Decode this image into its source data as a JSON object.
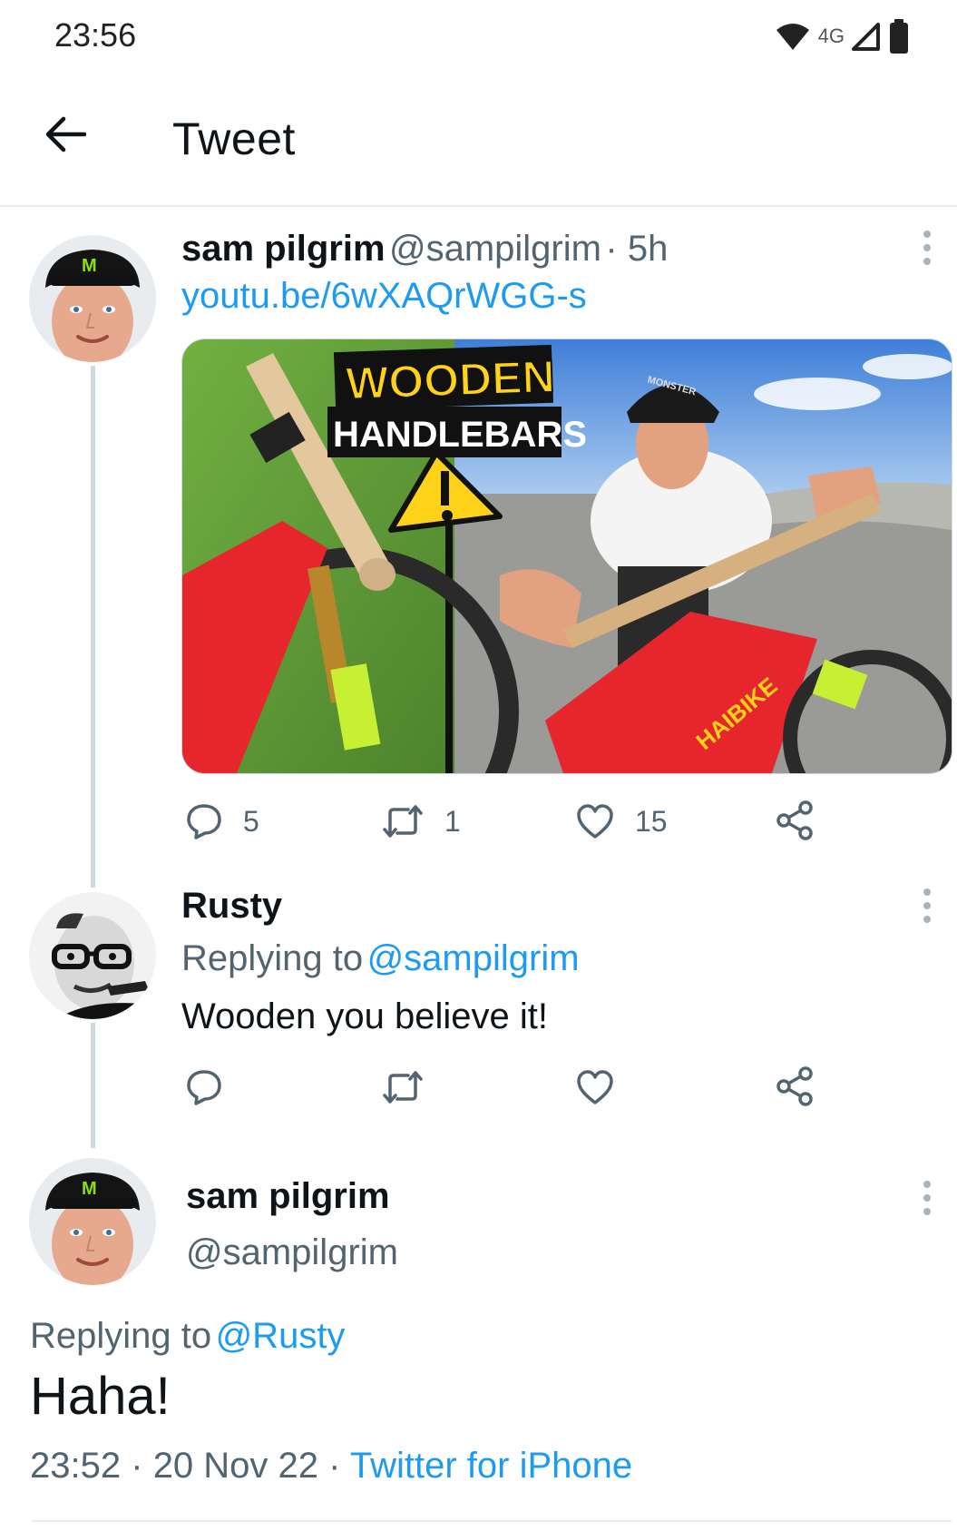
{
  "status_bar": {
    "time": "23:56",
    "network": "4G",
    "icons": [
      "wifi-icon",
      "cell-signal-icon",
      "battery-icon"
    ]
  },
  "header": {
    "title": "Tweet",
    "back_icon": "arrow-left-icon"
  },
  "tweets": [
    {
      "name": "sam pilgrim",
      "handle": "@sampilgrim",
      "time": "· 5h",
      "link": "youtu.be/6wXAQrWGG-s",
      "media": {
        "line1": "WOODEN",
        "line2": "HANDLEBARS",
        "helmet_text": "MONSTER",
        "frame_text": "HAIBIKE"
      },
      "actions": {
        "replies": "5",
        "retweets": "1",
        "likes": "15"
      }
    },
    {
      "name": "Rusty",
      "replying_prefix": "Replying to",
      "replying_to": "@sampilgrim",
      "text": "Wooden you believe it!"
    }
  ],
  "focused_tweet": {
    "name": "sam pilgrim",
    "handle": "@sampilgrim",
    "replying_prefix": "Replying to",
    "replying_to": "@Rusty",
    "text": "Haha!",
    "time": "23:52",
    "date": "20 Nov 22",
    "separator": "·",
    "source": "Twitter for iPhone"
  },
  "colors": {
    "accent": "#1d9bf0",
    "text": "#0f1419",
    "secondary": "#536471",
    "divider": "#e6ecf0"
  }
}
